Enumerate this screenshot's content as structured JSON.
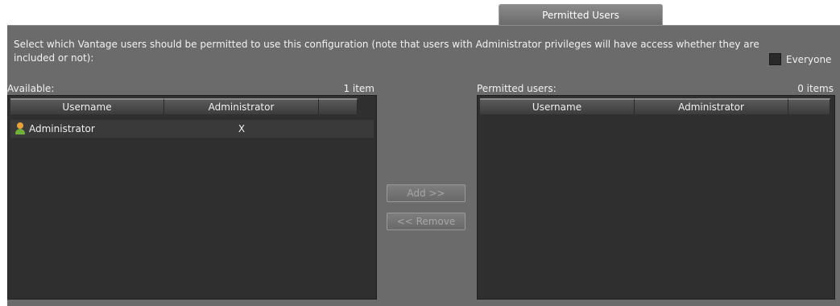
{
  "tab": {
    "label": "Permitted Users"
  },
  "description": "Select which Vantage users should be permitted to use this configuration (note that users with Administrator privileges will have access whether they are included or not):",
  "everyone": {
    "label": "Everyone",
    "checked": false
  },
  "available": {
    "title": "Available:",
    "count": "1 item",
    "columns": [
      "Username",
      "Administrator",
      ""
    ],
    "rows": [
      {
        "username": "Administrator",
        "administrator": "X",
        "icon": "user-icon"
      }
    ]
  },
  "permitted": {
    "title": "Permitted users:",
    "count": "0 items",
    "columns": [
      "Username",
      "Administrator",
      ""
    ],
    "rows": []
  },
  "buttons": {
    "add": "Add >>",
    "remove": "<< Remove"
  }
}
